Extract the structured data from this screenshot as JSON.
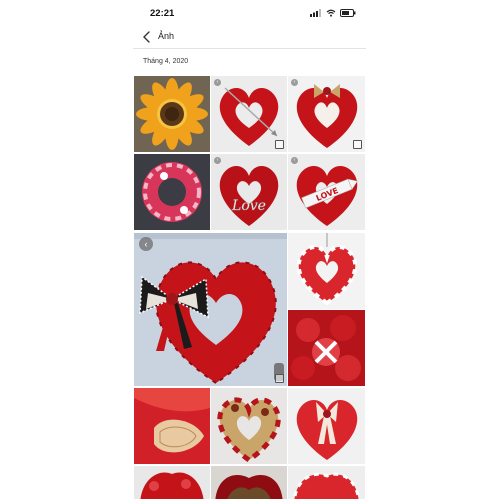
{
  "status_bar": {
    "time": "22:21"
  },
  "nav": {
    "title": "Ảnh"
  },
  "section": {
    "label": "Tháng 4, 2020"
  },
  "photos": [
    {
      "subject": "sunflower wreath",
      "sign": ""
    },
    {
      "subject": "red heart wreath with arrow",
      "sign": ""
    },
    {
      "subject": "heart wreath with bow",
      "sign": ""
    },
    {
      "subject": "pink round wreath",
      "sign": ""
    },
    {
      "subject": "heart wreath with Love sign",
      "sign": "Love"
    },
    {
      "subject": "heart wreath with arrow Love sign",
      "sign": "LOVE"
    },
    {
      "subject": "large red heart wreath with plaid bow",
      "sign": ""
    },
    {
      "subject": "red and white heart wreath",
      "sign": ""
    },
    {
      "subject": "red ruffle wreath",
      "sign": ""
    },
    {
      "subject": "red mesh heart",
      "sign": ""
    },
    {
      "subject": "burlap heart wreath",
      "sign": ""
    },
    {
      "subject": "red heart wreath with ribbons",
      "sign": ""
    },
    {
      "subject": "red wreath partial",
      "sign": ""
    },
    {
      "subject": "dark red wreath partial",
      "sign": ""
    },
    {
      "subject": "red wreath partial",
      "sign": ""
    }
  ],
  "icons": [
    "chevron-left-icon",
    "signal-icon",
    "wifi-icon",
    "battery-icon",
    "play-badge-icon",
    "select-corner-icon"
  ],
  "colors": {
    "wreath_red": "#c4141a",
    "dark_red": "#8e0c12",
    "pink": "#e96a8a",
    "sunflower": "#f0a21c",
    "burlap": "#c9a56a",
    "door_blue": "#c9d3df"
  }
}
